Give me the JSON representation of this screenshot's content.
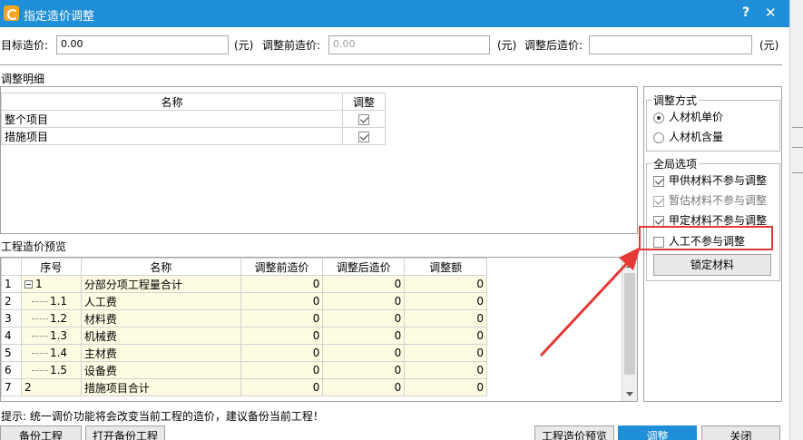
{
  "window": {
    "title": "指定造价调整",
    "help": "?",
    "close": "✕"
  },
  "top": {
    "target_label": "目标造价:",
    "target_value": "0.00",
    "unit1": "(元)",
    "before_label": "调整前造价:",
    "before_placeholder": "0.00",
    "unit2": "(元)",
    "after_label": "调整后造价:",
    "after_value": "",
    "unit3": "(元)"
  },
  "detail": {
    "section_label": "调整明细",
    "headers": [
      "名称",
      "调整"
    ],
    "rows": [
      {
        "name": "整个项目",
        "checked": true
      },
      {
        "name": "措施项目",
        "checked": true
      }
    ]
  },
  "preview": {
    "section_label": "工程造价预览",
    "headers": [
      "序号",
      "名称",
      "调整前造价",
      "调整后造价",
      "调整额"
    ],
    "rows": [
      {
        "idx": "1",
        "seq": "1",
        "name": "分部分项工程量合计",
        "before": "0",
        "after": "0",
        "diff": "0",
        "tree": "root"
      },
      {
        "idx": "2",
        "seq": "1.1",
        "name": "人工费",
        "before": "0",
        "after": "0",
        "diff": "0",
        "tree": "child"
      },
      {
        "idx": "3",
        "seq": "1.2",
        "name": "材料费",
        "before": "0",
        "after": "0",
        "diff": "0",
        "tree": "child"
      },
      {
        "idx": "4",
        "seq": "1.3",
        "name": "机械费",
        "before": "0",
        "after": "0",
        "diff": "0",
        "tree": "child"
      },
      {
        "idx": "5",
        "seq": "1.4",
        "name": "主材费",
        "before": "0",
        "after": "0",
        "diff": "0",
        "tree": "child"
      },
      {
        "idx": "6",
        "seq": "1.5",
        "name": "设备费",
        "before": "0",
        "after": "0",
        "diff": "0",
        "tree": "child"
      },
      {
        "idx": "7",
        "seq": "2",
        "name": "措施项目合计",
        "before": "0",
        "after": "0",
        "diff": "0",
        "tree": "plain"
      }
    ]
  },
  "adjust_mode": {
    "legend": "调整方式",
    "options": [
      {
        "label": "人材机单价",
        "selected": true
      },
      {
        "label": "人材机含量",
        "selected": false
      }
    ]
  },
  "global_options": {
    "legend": "全局选项",
    "items": [
      {
        "label": "甲供材料不参与调整",
        "checked": true,
        "dim": false
      },
      {
        "label": "暂估材料不参与调整",
        "checked": true,
        "dim": true
      },
      {
        "label": "甲定材料不参与调整",
        "checked": true,
        "dim": false
      },
      {
        "label": "人工不参与调整",
        "checked": false,
        "dim": false
      }
    ],
    "lock_button": "锁定材料"
  },
  "hint": "提示: 统一调价功能将会改变当前工程的造价，建议备份当前工程！",
  "buttons": {
    "backup": "备份工程",
    "open_backup": "打开备份工程",
    "preview": "工程造价预览",
    "adjust": "调整",
    "close": "关闭"
  },
  "colors": {
    "titlebar": "#1e8fd8",
    "highlight": "#e53935",
    "row_bg": "#fdfbe2"
  }
}
